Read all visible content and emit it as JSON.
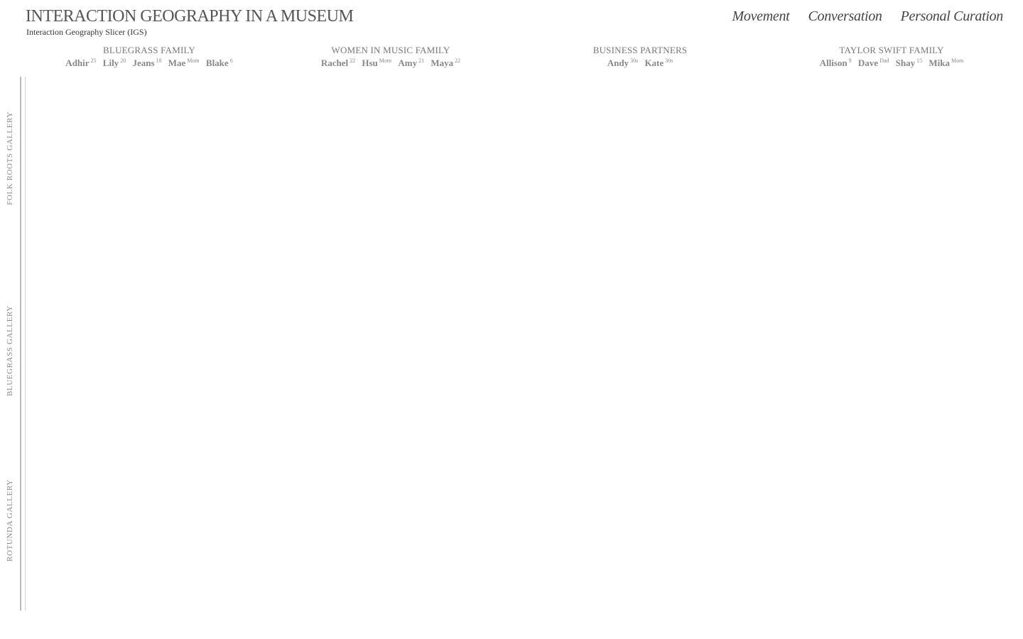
{
  "header": {
    "title": "INTERACTION GEOGRAPHY IN A MUSEUM",
    "subtitle": "Interaction Geography Slicer (IGS)"
  },
  "nav": {
    "items": [
      {
        "label": "Movement"
      },
      {
        "label": "Conversation"
      },
      {
        "label": "Personal Curation"
      }
    ]
  },
  "groups": [
    {
      "name": "BLUEGRASS FAMILY",
      "members": [
        {
          "name": "Adhir",
          "tag": "25"
        },
        {
          "name": "Lily",
          "tag": "20"
        },
        {
          "name": "Jeans",
          "tag": "10"
        },
        {
          "name": "Mae",
          "tag": "Mom"
        },
        {
          "name": "Blake",
          "tag": "6"
        }
      ]
    },
    {
      "name": "WOMEN IN MUSIC FAMILY",
      "members": [
        {
          "name": "Rachel",
          "tag": "22"
        },
        {
          "name": "Hsu",
          "tag": "Mom"
        },
        {
          "name": "Amy",
          "tag": "21"
        },
        {
          "name": "Maya",
          "tag": "22"
        }
      ]
    },
    {
      "name": "BUSINESS PARTNERS",
      "members": [
        {
          "name": "Andy",
          "tag": "30s"
        },
        {
          "name": "Kate",
          "tag": "30s"
        }
      ]
    },
    {
      "name": "TAYLOR SWIFT FAMILY",
      "members": [
        {
          "name": "Allison",
          "tag": "9"
        },
        {
          "name": "Dave",
          "tag": "Dad"
        },
        {
          "name": "Shay",
          "tag": "15"
        },
        {
          "name": "Mika",
          "tag": "Mom"
        }
      ]
    }
  ],
  "galleries": [
    {
      "label": "FOLK ROOTS GALLERY"
    },
    {
      "label": "BLUEGRASS GALLERY"
    },
    {
      "label": "ROTUNDA GALLERY"
    }
  ]
}
